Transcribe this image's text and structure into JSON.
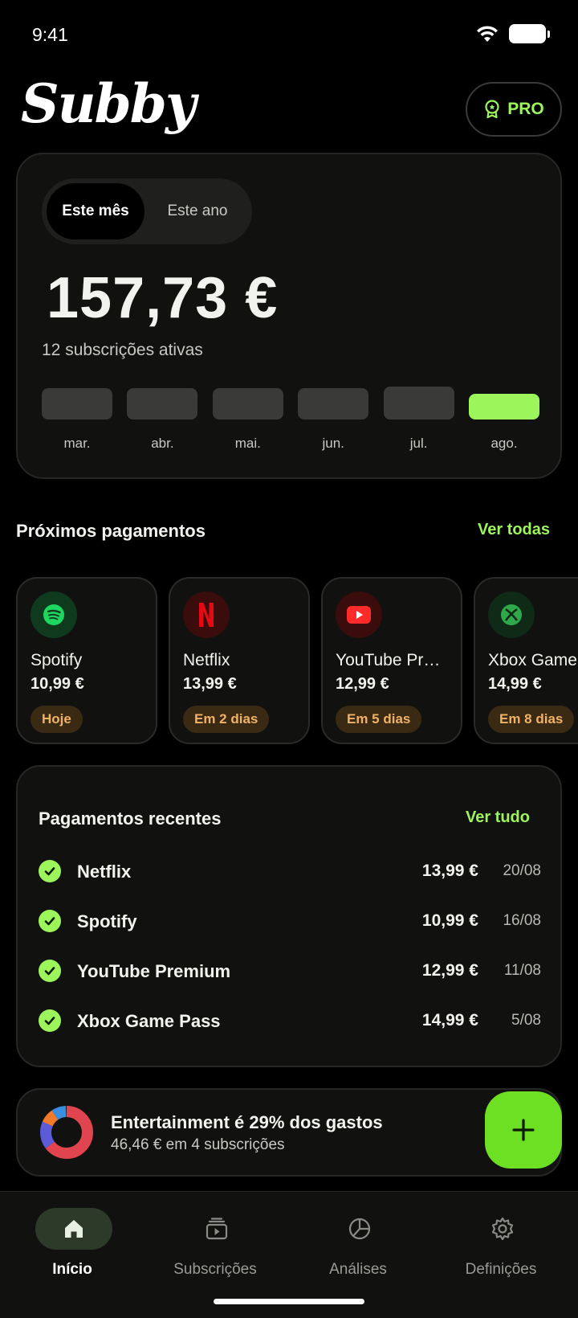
{
  "status": {
    "time": "9:41"
  },
  "header": {
    "logo": "Subby",
    "pro_label": "PRO"
  },
  "summary": {
    "toggle": [
      "Este mês",
      "Este ano"
    ],
    "selected_toggle": "Este mês",
    "total": "157,73 €",
    "active_subscriptions": "12 subscrições ativas",
    "months": [
      {
        "label": "mar.",
        "level": 0.42
      },
      {
        "label": "abr.",
        "level": 0.42
      },
      {
        "label": "mai.",
        "level": 0.42
      },
      {
        "label": "jun.",
        "level": 0.42
      },
      {
        "label": "jul.",
        "level": 0.45
      },
      {
        "label": "ago.",
        "level": 0.35,
        "current": true
      }
    ]
  },
  "upcoming": {
    "title": "Próximos pagamentos",
    "link": "Ver todas",
    "items": [
      {
        "name": "Spotify",
        "price": "10,99 €",
        "badge": "Hoje",
        "icon": "spotify-icon",
        "color": "#1ed760",
        "bg": "#0f3a1e"
      },
      {
        "name": "Netflix",
        "price": "13,99 €",
        "badge": "Em 2 dias",
        "icon": "netflix-icon",
        "color": "#e50914",
        "bg": "#3a0c0c"
      },
      {
        "name": "YouTube Pr…",
        "price": "12,99 €",
        "badge": "Em 5 dias",
        "icon": "youtube-icon",
        "color": "#ff2a2a",
        "bg": "#3a0c0c"
      },
      {
        "name": "Xbox Game",
        "price": "14,99 €",
        "badge": "Em 8 dias",
        "icon": "xbox-icon",
        "color": "#2ea84a",
        "bg": "#0f2a16"
      }
    ]
  },
  "recent": {
    "title": "Pagamentos recentes",
    "link": "Ver tudo",
    "rows": [
      {
        "name": "Netflix",
        "price": "13,99 €",
        "date": "20/08"
      },
      {
        "name": "Spotify",
        "price": "10,99 €",
        "date": "16/08"
      },
      {
        "name": "YouTube Premium",
        "price": "12,99 €",
        "date": "11/08"
      },
      {
        "name": "Xbox Game Pass",
        "price": "14,99 €",
        "date": "5/08"
      }
    ]
  },
  "insight": {
    "title": "Entertainment é 29% dos gastos",
    "subtitle": "46,46 € em 4 subscrições"
  },
  "fab": {
    "icon": "plus-icon"
  },
  "tabs": [
    {
      "label": "Início",
      "icon": "home-icon",
      "active": true
    },
    {
      "label": "Subscrições",
      "icon": "subscriptions-icon"
    },
    {
      "label": "Análises",
      "icon": "analytics-icon"
    },
    {
      "label": "Definições",
      "icon": "gear-icon"
    }
  ],
  "colors": {
    "accent": "#9cf55a",
    "fab": "#6ee024",
    "badge_text": "#f0b266"
  }
}
